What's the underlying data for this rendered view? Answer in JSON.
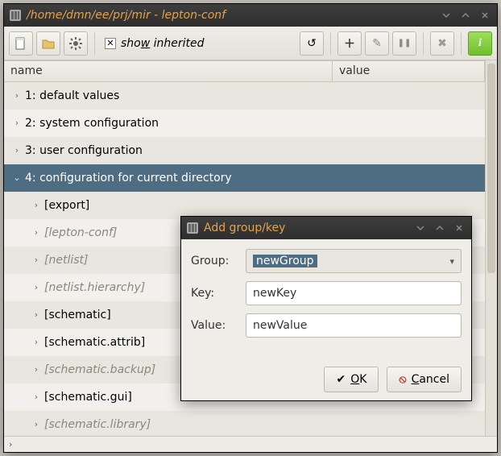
{
  "main": {
    "title": "/home/dmn/ee/prj/mir - lepton-conf",
    "toolbar": {
      "show_inherited_label_pre": "sho",
      "show_inherited_mnemonic": "w",
      "show_inherited_label_post": " inherited",
      "show_inherited_checked": true
    },
    "columns": {
      "name": "name",
      "value": "value"
    },
    "rows": [
      {
        "expander": "›",
        "indent": 1,
        "label": "1: default values",
        "muted": false,
        "selected": false
      },
      {
        "expander": "›",
        "indent": 1,
        "label": "2: system configuration",
        "muted": false,
        "selected": false
      },
      {
        "expander": "›",
        "indent": 1,
        "label": "3: user configuration",
        "muted": false,
        "selected": false
      },
      {
        "expander": "⌄",
        "indent": 1,
        "label": "4: configuration for current directory",
        "muted": false,
        "selected": true
      },
      {
        "expander": "›",
        "indent": 2,
        "label": "[export]",
        "muted": false,
        "selected": false
      },
      {
        "expander": "›",
        "indent": 2,
        "label": "[lepton-conf]",
        "muted": true,
        "selected": false
      },
      {
        "expander": "›",
        "indent": 2,
        "label": "[netlist]",
        "muted": true,
        "selected": false
      },
      {
        "expander": "›",
        "indent": 2,
        "label": "[netlist.hierarchy]",
        "muted": true,
        "selected": false
      },
      {
        "expander": "›",
        "indent": 2,
        "label": "[schematic]",
        "muted": false,
        "selected": false
      },
      {
        "expander": "›",
        "indent": 2,
        "label": "[schematic.attrib]",
        "muted": false,
        "selected": false
      },
      {
        "expander": "›",
        "indent": 2,
        "label": "[schematic.backup]",
        "muted": true,
        "selected": false
      },
      {
        "expander": "›",
        "indent": 2,
        "label": "[schematic.gui]",
        "muted": false,
        "selected": false
      },
      {
        "expander": "›",
        "indent": 2,
        "label": "[schematic.library]",
        "muted": true,
        "selected": false
      }
    ],
    "status_chevron": "›"
  },
  "dialog": {
    "title": "Add group/key",
    "group_label": "Group:",
    "key_label": "Key:",
    "value_label": "Value:",
    "group_value": "newGroup",
    "key_value": "newKey",
    "value_value": "newValue",
    "ok_mnemonic": "O",
    "ok_rest": "K",
    "cancel_mnemonic": "C",
    "cancel_rest": "ancel"
  },
  "icons": {
    "reload": "↺",
    "add": "＋",
    "edit": "✎",
    "pause": "❚❚",
    "delete": "✖",
    "info": "i"
  }
}
